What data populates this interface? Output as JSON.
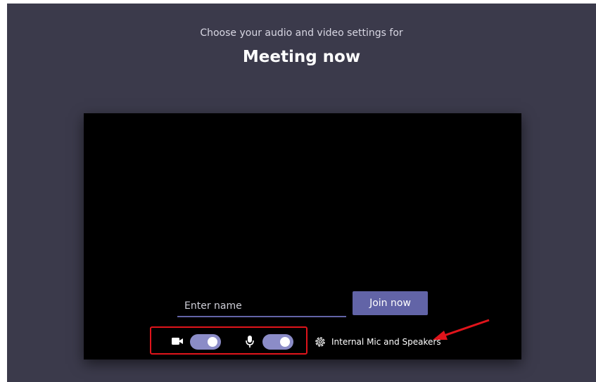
{
  "header": {
    "subtitle": "Choose your audio and video settings for",
    "title": "Meeting now"
  },
  "name_input": {
    "placeholder": "Enter name",
    "value": ""
  },
  "join_button": {
    "label": "Join now"
  },
  "controls": {
    "camera": {
      "icon": "camera-icon",
      "enabled": true
    },
    "microphone": {
      "icon": "microphone-icon",
      "enabled": true
    },
    "device_settings": {
      "icon": "gear-icon",
      "label": "Internal Mic and Speakers"
    }
  },
  "colors": {
    "background": "#3b3a4b",
    "preview": "#000000",
    "accent": "#6264a7",
    "toggle_on": "#8b8cc7",
    "highlight_box": "#e0141b",
    "annotation_arrow": "#e0141b"
  }
}
